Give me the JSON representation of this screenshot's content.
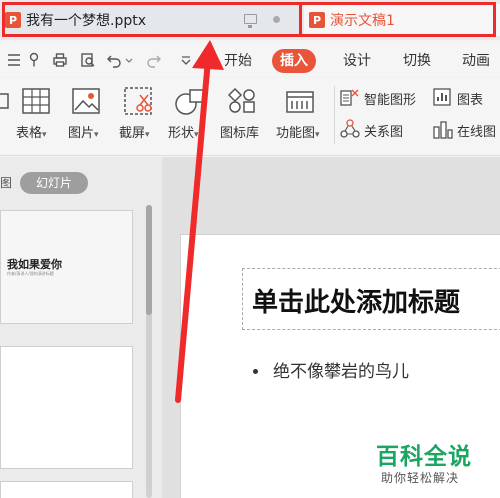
{
  "tabs": [
    {
      "label": "我有一个梦想.pptx",
      "logo": "P"
    },
    {
      "label": "演示文稿1",
      "logo": "P"
    }
  ],
  "menu": [
    "开始",
    "插入",
    "设计",
    "切换",
    "动画"
  ],
  "menu_active": "插入",
  "ribbon": {
    "table": "表格",
    "picture": "图片",
    "screenshot": "截屏",
    "shape": "形状",
    "icon_library": "图标库",
    "function_chart": "功能图",
    "smart_graphic": "智能图形",
    "chart": "图表",
    "relation_chart": "关系图",
    "online_chart": "在线图"
  },
  "left_panel": {
    "view_tab_outline": "图",
    "view_tab_slides": "幻灯片",
    "thumb1_title": "我如果爱你",
    "thumb1_subtitle": "作者/演讲人/我的演讲标题"
  },
  "slide": {
    "title_placeholder": "单击此处添加标题",
    "bullet": "绝不像攀岩的鸟儿"
  },
  "watermark": {
    "title": "百科全说",
    "subtitle": "助你轻松解决"
  },
  "colors": {
    "accent": "#e8553a",
    "annotation": "#ee2a2a",
    "watermark": "#1aa660"
  }
}
